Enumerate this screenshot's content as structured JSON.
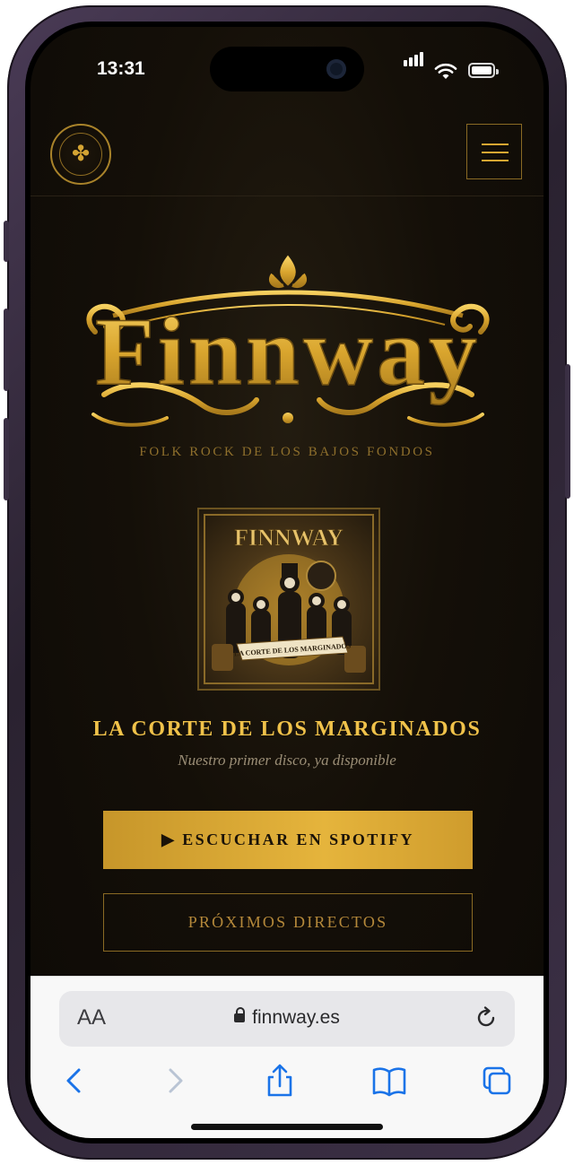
{
  "status_bar": {
    "time": "13:31"
  },
  "site": {
    "logo_text": "Finnway",
    "tagline": "FOLK ROCK DE LOS BAJOS FONDOS",
    "album_art_title": "FINNWAY",
    "album_art_banner": "LA CORTE DE LOS MARGINADOS",
    "album_title": "LA CORTE DE LOS MARGINADOS",
    "album_subtitle": "Nuestro primer disco, ya disponible",
    "spotify_label": "▶ ESCUCHAR EN SPOTIFY",
    "directos_label": "PRÓXIMOS DIRECTOS"
  },
  "browser": {
    "aa_label": "AA",
    "url": "finnway.es"
  },
  "icons": {
    "seal": "band-seal-icon",
    "menu": "hamburger-menu-icon",
    "back": "back-icon",
    "forward": "forward-icon",
    "share": "share-icon",
    "bookmarks": "bookmarks-icon",
    "tabs": "tabs-icon",
    "reload": "reload-icon"
  },
  "colors": {
    "gold": "#e5b43c",
    "gold_dark": "#8a6a24",
    "background": "#0d0a06",
    "safari_blue": "#1a73e8"
  }
}
